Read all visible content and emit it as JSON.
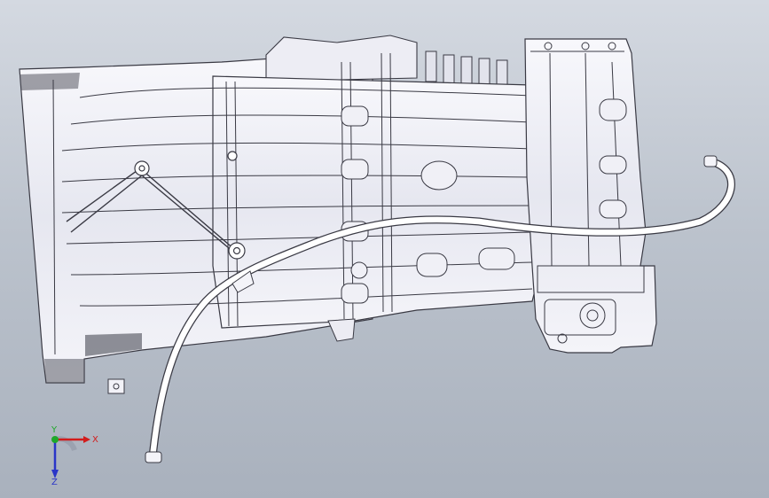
{
  "viewport": {
    "colors": {
      "background_top": "#d4d9e1",
      "background_bottom": "#a9b1bd",
      "edge": "#3a3a44",
      "face": "#f3f3f8",
      "shade": "#cfd0dc"
    }
  },
  "triad": {
    "x_label": "X",
    "y_label": "Y",
    "z_label": "Z",
    "colors": {
      "x": "#d21c1c",
      "y": "#1ea82a",
      "z": "#2a35c8"
    }
  }
}
